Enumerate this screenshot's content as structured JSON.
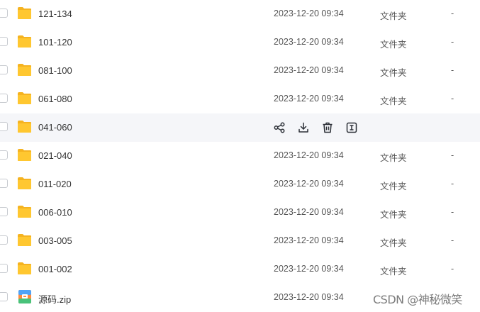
{
  "rows": [
    {
      "name": "121-134",
      "date": "2023-12-20 09:34",
      "type": "文件夹",
      "size": "-",
      "icon": "folder-icon"
    },
    {
      "name": "101-120",
      "date": "2023-12-20 09:34",
      "type": "文件夹",
      "size": "-",
      "icon": "folder-icon"
    },
    {
      "name": "081-100",
      "date": "2023-12-20 09:34",
      "type": "文件夹",
      "size": "-",
      "icon": "folder-icon"
    },
    {
      "name": "061-080",
      "date": "2023-12-20 09:34",
      "type": "文件夹",
      "size": "-",
      "icon": "folder-icon"
    },
    {
      "name": "041-060",
      "icon": "folder-icon",
      "hovered": true
    },
    {
      "name": "021-040",
      "date": "2023-12-20 09:34",
      "type": "文件夹",
      "size": "-",
      "icon": "folder-icon"
    },
    {
      "name": "011-020",
      "date": "2023-12-20 09:34",
      "type": "文件夹",
      "size": "-",
      "icon": "folder-icon"
    },
    {
      "name": "006-010",
      "date": "2023-12-20 09:34",
      "type": "文件夹",
      "size": "-",
      "icon": "folder-icon"
    },
    {
      "name": "003-005",
      "date": "2023-12-20 09:34",
      "type": "文件夹",
      "size": "-",
      "icon": "folder-icon"
    },
    {
      "name": "001-002",
      "date": "2023-12-20 09:34",
      "type": "文件夹",
      "size": "-",
      "icon": "folder-icon"
    },
    {
      "name": "源码.zip",
      "date": "2023-12-20 09:34",
      "type": "",
      "size": "",
      "icon": "zip-icon"
    }
  ],
  "hover_actions": [
    "share-icon",
    "download-icon",
    "delete-icon",
    "more-icon"
  ],
  "watermark": "CSDN @神秘微笑",
  "colors": {
    "folder": "#FFC730",
    "folder_back": "#F5B320",
    "hover_bg": "#f5f6f9",
    "icon_dark": "#2b2f36"
  }
}
